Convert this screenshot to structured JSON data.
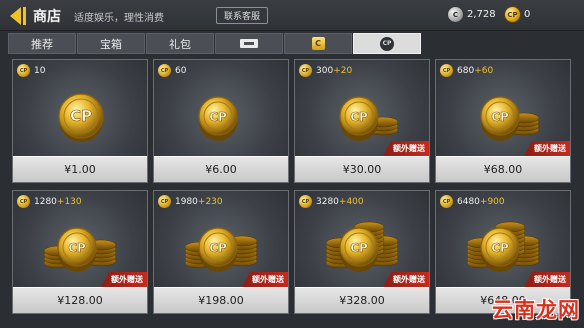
{
  "header": {
    "title": "商店",
    "subtitle": "适度娱乐，理性消费",
    "support_label": "联系客服"
  },
  "wallet": {
    "c_icon_label": "C",
    "c_amount": "2,728",
    "cp_icon_label": "CP",
    "cp_amount": "0"
  },
  "tabs": [
    {
      "label": "推荐",
      "icon": null
    },
    {
      "label": "宝箱",
      "icon": null
    },
    {
      "label": "礼包",
      "icon": null
    },
    {
      "label": "",
      "icon": "ticket-icon"
    },
    {
      "label": "C",
      "icon": "c-currency-icon"
    },
    {
      "label": "CP",
      "icon": "cp-currency-icon",
      "active": true
    }
  ],
  "coin_label": "CP",
  "mini_coin_label": "CP",
  "bonus_label": "额外赠送",
  "products": [
    {
      "amount": "10",
      "bonus": "",
      "price": "¥1.00",
      "has_tag": false,
      "stack": 1
    },
    {
      "amount": "60",
      "bonus": "",
      "price": "¥6.00",
      "has_tag": false,
      "stack": 2
    },
    {
      "amount": "300",
      "bonus": "+20",
      "price": "¥30.00",
      "has_tag": true,
      "stack": 3
    },
    {
      "amount": "680",
      "bonus": "+60",
      "price": "¥68.00",
      "has_tag": true,
      "stack": 4
    },
    {
      "amount": "1280",
      "bonus": "+130",
      "price": "¥128.00",
      "has_tag": true,
      "stack": 5
    },
    {
      "amount": "1980",
      "bonus": "+230",
      "price": "¥198.00",
      "has_tag": true,
      "stack": 6
    },
    {
      "amount": "3280",
      "bonus": "+400",
      "price": "¥328.00",
      "has_tag": true,
      "stack": 7
    },
    {
      "amount": "6480",
      "bonus": "+900",
      "price": "¥648.00",
      "has_tag": true,
      "stack": 8
    }
  ],
  "watermark": "云南龙网",
  "colors": {
    "accent": "#f0c22a",
    "bonus_tag": "#c62a1d",
    "price_bar": "#dcdcdc",
    "background": "#2b2e33"
  }
}
